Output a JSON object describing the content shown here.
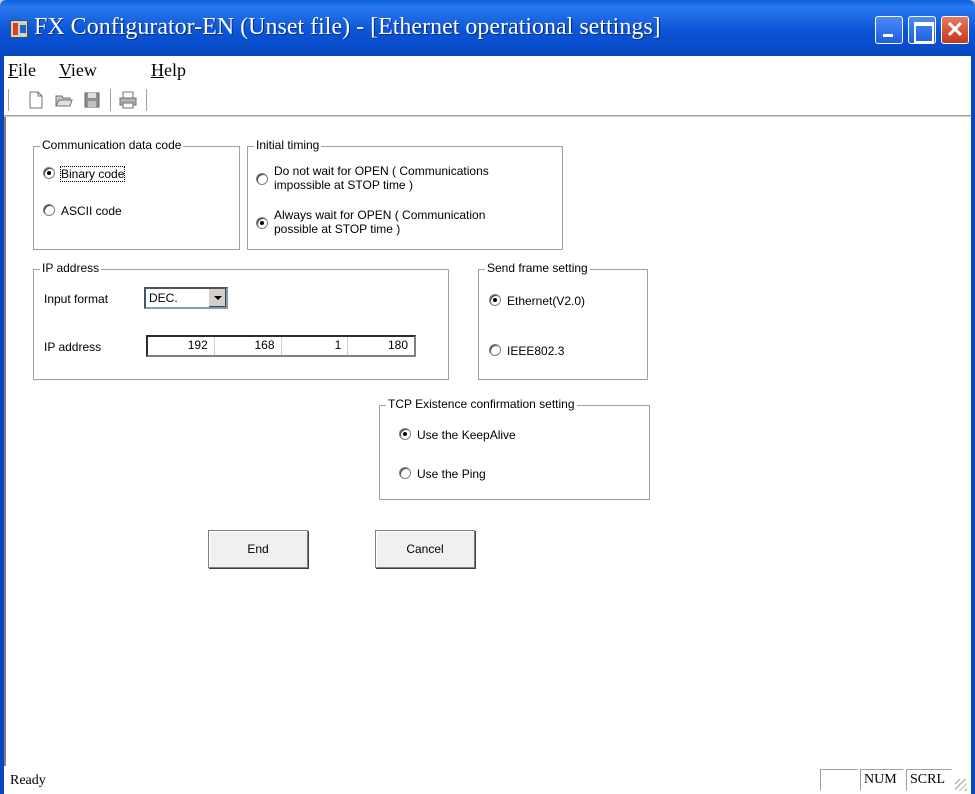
{
  "window": {
    "title": "FX Configurator-EN (Unset file) - [Ethernet operational settings]",
    "close_glyph": "✕"
  },
  "menu": {
    "file": {
      "first": "F",
      "rest": "ile"
    },
    "view": {
      "first": "V",
      "rest": "iew"
    },
    "help": {
      "first": "H",
      "rest": "elp"
    }
  },
  "toolbar": {
    "icons": [
      "new-file-icon",
      "open-folder-icon",
      "save-disk-icon",
      "print-icon"
    ]
  },
  "communication_data_code": {
    "label": "Communication data code",
    "options": [
      {
        "label": "Binary code",
        "checked": true
      },
      {
        "label": "ASCII code",
        "checked": false
      }
    ]
  },
  "initial_timing": {
    "label": "Initial timing",
    "options": [
      {
        "line1": "Do not wait for OPEN ( Communications",
        "line2": "impossible at STOP time )",
        "checked": false
      },
      {
        "line1": "Always wait for OPEN ( Communication",
        "line2": "possible at STOP time )",
        "checked": true
      }
    ]
  },
  "ip_address": {
    "group_label": "IP address",
    "input_format_label": "Input format",
    "input_format_value": "DEC.",
    "ip_label": "IP address",
    "octets": [
      "192",
      "168",
      "1",
      "180"
    ]
  },
  "send_frame_setting": {
    "label": "Send frame setting",
    "options": [
      {
        "label": "Ethernet(V2.0)",
        "checked": true
      },
      {
        "label": "IEEE802.3",
        "checked": false
      }
    ]
  },
  "tcp_existence": {
    "label": "TCP Existence confirmation setting",
    "options": [
      {
        "label": "Use the KeepAlive",
        "checked": true
      },
      {
        "label": "Use the Ping",
        "checked": false
      }
    ]
  },
  "buttons": {
    "end": "End",
    "cancel": "Cancel"
  },
  "status": {
    "text": "Ready",
    "num": "NUM",
    "scrl": "SCRL"
  }
}
